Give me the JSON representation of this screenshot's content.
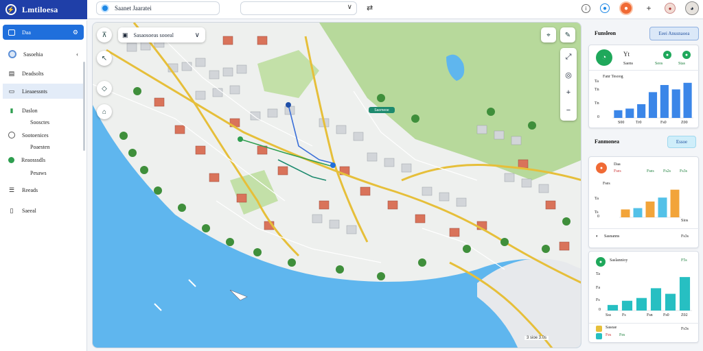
{
  "brand": {
    "title": "Lmtiloesa",
    "logo_icon": "bolt-icon"
  },
  "search": {
    "text": "Saanet  Jaaratei"
  },
  "address": {
    "value": ""
  },
  "sidebar": {
    "items": [
      {
        "label": "Daa",
        "icon": "window-icon",
        "state": "active"
      },
      {
        "label": "Sasoehia",
        "icon": "circle-icon",
        "state": "normal"
      },
      {
        "label": "Deadsolts",
        "icon": "document-icon",
        "state": "normal"
      },
      {
        "label": "Lieaaessnts",
        "icon": "folder-icon",
        "state": "highlight"
      },
      {
        "label": "Daslon",
        "icon": "chart-icon",
        "state": "normal"
      },
      {
        "label": "Soosctes",
        "icon": "sub",
        "state": "sub"
      },
      {
        "label": "Sootoenices",
        "icon": "ring-icon",
        "state": "normal"
      },
      {
        "label": "Poaesten",
        "icon": "sub",
        "state": "sub"
      },
      {
        "label": "Reaosssdls",
        "icon": "green-dot-icon",
        "state": "normal"
      },
      {
        "label": "Pesaws",
        "icon": "sub",
        "state": "sub"
      },
      {
        "label": "Reeads",
        "icon": "list-icon",
        "state": "normal"
      },
      {
        "label": "Saeeal",
        "icon": "page-icon",
        "state": "normal"
      }
    ]
  },
  "map": {
    "search_text": "Sasaosoeas  sooeal",
    "badge": "Saomeoe",
    "scale": "3 sioe  3.0s"
  },
  "panel": {
    "title": "Funsleon",
    "button": "Eeei Anusnaoea",
    "section2_title": "Fanmonea",
    "section2_button": "Essoe"
  },
  "card1": {
    "stat1_value": "Yt",
    "stat1_label": "Saens",
    "stat2_value": "Hs",
    "stat2_label": "Seos",
    "stat3_label": "Stas",
    "chart_title": "Fanr Tesoog",
    "ticks": [
      "Ta",
      "Tn",
      "Tn",
      "0"
    ],
    "xlabels": [
      "S00",
      "Tr0",
      "Fs0",
      "Z00"
    ]
  },
  "card2": {
    "title": "Daa",
    "subtitle": "Fses",
    "stat1": "Fses",
    "stat2": "Fs2s",
    "stat3": "Fs3s",
    "ticks": [
      "Ta",
      "Ts",
      "0"
    ],
    "xlabel": "Sios",
    "footer_label": "Sasnanns",
    "footer_value": "Fs3s"
  },
  "card3": {
    "title": "Saslannioy",
    "value": "F5s",
    "ticks": [
      "Ta",
      "Fa",
      "Fs",
      "0"
    ],
    "xlabels": [
      "Sss",
      "Fs",
      "Fsn",
      "Fs0",
      "Z02"
    ],
    "footer1_label": "Saseae",
    "footer1_value": "Fs3s",
    "footer2_label": "Fes",
    "footer2_value": "Fes"
  },
  "chart_data": [
    {
      "type": "bar",
      "categories": [
        "1",
        "2",
        "3",
        "4",
        "5",
        "6",
        "7"
      ],
      "values": [
        14,
        17,
        25,
        47,
        60,
        52,
        64
      ],
      "ylim": [
        0,
        70
      ]
    },
    {
      "type": "bar",
      "categories": [
        "1",
        "2",
        "3",
        "4",
        "5"
      ],
      "values": [
        12,
        14,
        24,
        30,
        42
      ],
      "ylim": [
        0,
        50
      ]
    },
    {
      "type": "bar",
      "categories": [
        "1",
        "2",
        "3",
        "4",
        "5",
        "6"
      ],
      "values": [
        8,
        14,
        18,
        32,
        24,
        48
      ],
      "ylim": [
        0,
        55
      ]
    }
  ],
  "colors": {
    "brand": "#1f3fa8",
    "accent": "#1f6fdc",
    "water": "#5fb6ee",
    "park": "#a8d08a",
    "road": "#e6bf3a",
    "chart1": "#3b86e8",
    "chart2": [
      "#f2a43a",
      "#53c1e8"
    ],
    "chart3": "#27bfc2"
  }
}
